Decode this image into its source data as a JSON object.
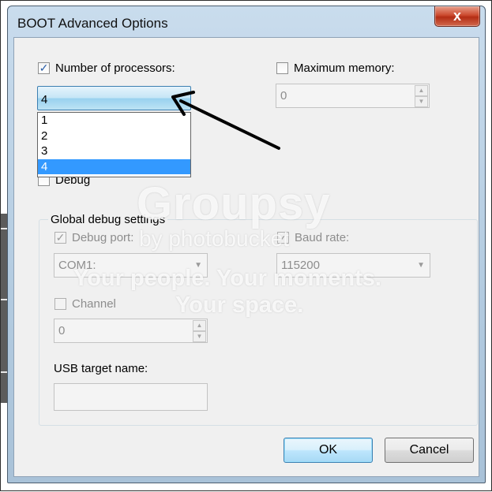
{
  "window": {
    "title": "BOOT Advanced Options",
    "close_glyph": "x"
  },
  "processors": {
    "label": "Number of processors:",
    "checked": true,
    "selected": "4",
    "options": [
      "1",
      "2",
      "3",
      "4"
    ]
  },
  "memory": {
    "label": "Maximum memory:",
    "checked": false,
    "value": "0"
  },
  "debug": {
    "label": "Debug",
    "checked": false
  },
  "global_debug": {
    "title": "Global debug settings",
    "debug_port": {
      "label": "Debug port:",
      "checked": true,
      "value": "COM1:"
    },
    "baud_rate": {
      "label": "Baud rate:",
      "checked": true,
      "value": "115200"
    },
    "channel": {
      "label": "Channel",
      "checked": false,
      "value": "0"
    },
    "usb": {
      "label": "USB target name:",
      "value": ""
    }
  },
  "buttons": {
    "ok": "OK",
    "cancel": "Cancel"
  },
  "watermark": {
    "brand": "Groupsy",
    "by": "by photobucket",
    "line1": "Your people. Your moments.",
    "line2": "Your space."
  },
  "icons": {
    "checkmark": "checkmark-icon",
    "arrow": "pointer-arrow-icon"
  },
  "colors": {
    "selection": "#3399ff",
    "ok_button": "#bee6fd",
    "close_button": "#c4452a"
  }
}
